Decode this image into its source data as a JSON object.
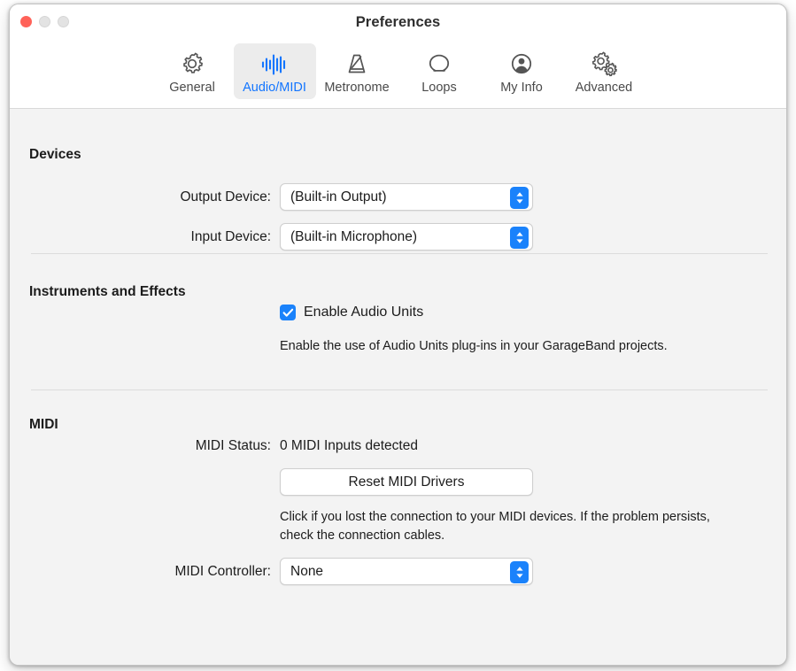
{
  "window": {
    "title": "Preferences",
    "traffic_lights": [
      {
        "name": "close",
        "color": "#ff6259",
        "enabled": true
      },
      {
        "name": "minimize",
        "color": "#e3e3e3",
        "enabled": false
      },
      {
        "name": "zoom",
        "color": "#e3e3e3",
        "enabled": false
      }
    ]
  },
  "toolbar": {
    "selected": "Audio/MIDI",
    "accent_color": "#1275ff",
    "items": [
      {
        "label": "General",
        "icon": "gear-icon"
      },
      {
        "label": "Audio/MIDI",
        "icon": "waveform-icon"
      },
      {
        "label": "Metronome",
        "icon": "metronome-icon"
      },
      {
        "label": "Loops",
        "icon": "loop-icon"
      },
      {
        "label": "My Info",
        "icon": "person-circle-icon"
      },
      {
        "label": "Advanced",
        "icon": "double-gear-icon"
      }
    ]
  },
  "devices": {
    "section_title": "Devices",
    "output": {
      "label": "Output Device:",
      "value": "(Built-in Output)"
    },
    "input": {
      "label": "Input Device:",
      "value": "(Built-in Microphone)"
    }
  },
  "instruments": {
    "section_title": "Instruments and Effects",
    "audio_units": {
      "label": "Enable Audio Units",
      "checked": true,
      "help": "Enable the use of Audio Units plug-ins in your GarageBand projects."
    }
  },
  "midi": {
    "section_title": "MIDI",
    "status": {
      "label": "MIDI Status:",
      "value": "0 MIDI Inputs detected"
    },
    "reset_button": "Reset MIDI Drivers",
    "reset_help": "Click if you lost the connection to your MIDI devices. If the problem persists, check the connection cables.",
    "controller": {
      "label": "MIDI Controller:",
      "value": "None"
    }
  }
}
